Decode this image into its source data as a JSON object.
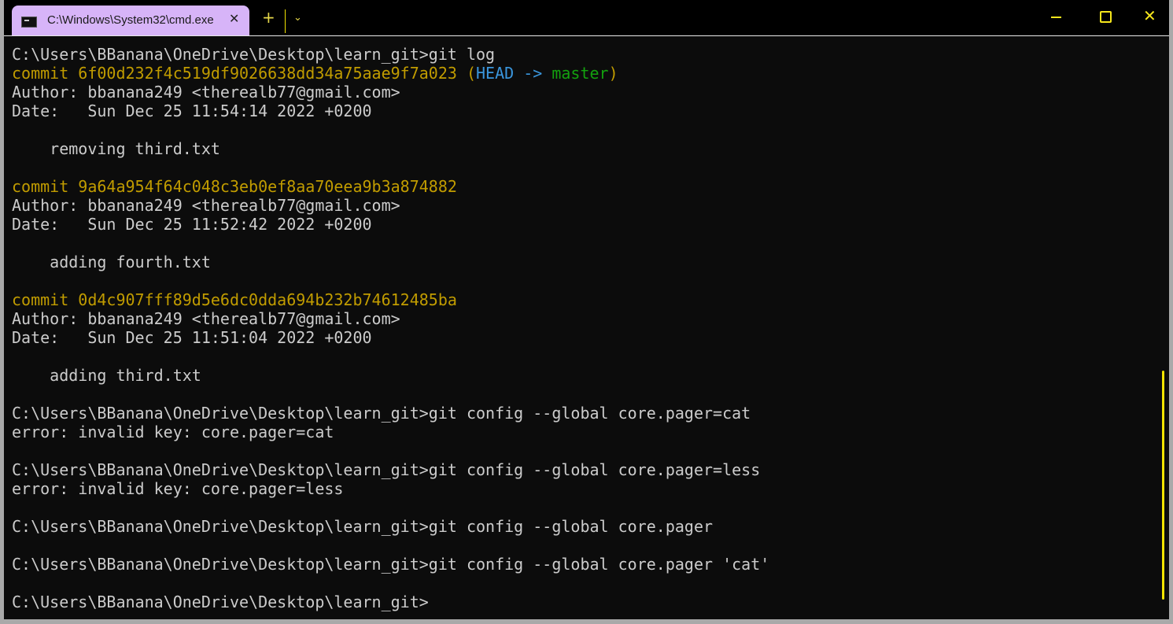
{
  "tab": {
    "title": "C:\\Windows\\System32\\cmd.exe",
    "close": "✕"
  },
  "toolbar": {
    "new_tab": "+",
    "dropdown": "⌄"
  },
  "window": {
    "close": "✕"
  },
  "colors": {
    "default": "#cccccc",
    "yellow": "#c19c00",
    "cyan": "#3a96dd",
    "green": "#13a10e",
    "accent": "#f5e61c"
  },
  "terminal": {
    "lines": [
      [
        {
          "t": "C:\\Users\\BBanana\\OneDrive\\Desktop\\learn_git>git log",
          "c": "default"
        }
      ],
      [
        {
          "t": "commit 6f00d232f4c519df9026638dd34a75aae9f7a023 ",
          "c": "yellow"
        },
        {
          "t": "(",
          "c": "yellow"
        },
        {
          "t": "HEAD -> ",
          "c": "cyan"
        },
        {
          "t": "master",
          "c": "green"
        },
        {
          "t": ")",
          "c": "yellow"
        }
      ],
      [
        {
          "t": "Author: bbanana249 <therealb77@gmail.com>",
          "c": "default"
        }
      ],
      [
        {
          "t": "Date:   Sun Dec 25 11:54:14 2022 +0200",
          "c": "default"
        }
      ],
      [],
      [
        {
          "t": "    removing third.txt",
          "c": "default"
        }
      ],
      [],
      [
        {
          "t": "commit 9a64a954f64c048c3eb0ef8aa70eea9b3a874882",
          "c": "yellow"
        }
      ],
      [
        {
          "t": "Author: bbanana249 <therealb77@gmail.com>",
          "c": "default"
        }
      ],
      [
        {
          "t": "Date:   Sun Dec 25 11:52:42 2022 +0200",
          "c": "default"
        }
      ],
      [],
      [
        {
          "t": "    adding fourth.txt",
          "c": "default"
        }
      ],
      [],
      [
        {
          "t": "commit 0d4c907fff89d5e6dc0dda694b232b74612485ba",
          "c": "yellow"
        }
      ],
      [
        {
          "t": "Author: bbanana249 <therealb77@gmail.com>",
          "c": "default"
        }
      ],
      [
        {
          "t": "Date:   Sun Dec 25 11:51:04 2022 +0200",
          "c": "default"
        }
      ],
      [],
      [
        {
          "t": "    adding third.txt",
          "c": "default"
        }
      ],
      [],
      [
        {
          "t": "C:\\Users\\BBanana\\OneDrive\\Desktop\\learn_git>git config --global core.pager=cat",
          "c": "default"
        }
      ],
      [
        {
          "t": "error: invalid key: core.pager=cat",
          "c": "default"
        }
      ],
      [],
      [
        {
          "t": "C:\\Users\\BBanana\\OneDrive\\Desktop\\learn_git>git config --global core.pager=less",
          "c": "default"
        }
      ],
      [
        {
          "t": "error: invalid key: core.pager=less",
          "c": "default"
        }
      ],
      [],
      [
        {
          "t": "C:\\Users\\BBanana\\OneDrive\\Desktop\\learn_git>git config --global core.pager",
          "c": "default"
        }
      ],
      [],
      [
        {
          "t": "C:\\Users\\BBanana\\OneDrive\\Desktop\\learn_git>git config --global core.pager 'cat'",
          "c": "default"
        }
      ],
      [],
      [
        {
          "t": "C:\\Users\\BBanana\\OneDrive\\Desktop\\learn_git>",
          "c": "default"
        }
      ]
    ]
  }
}
